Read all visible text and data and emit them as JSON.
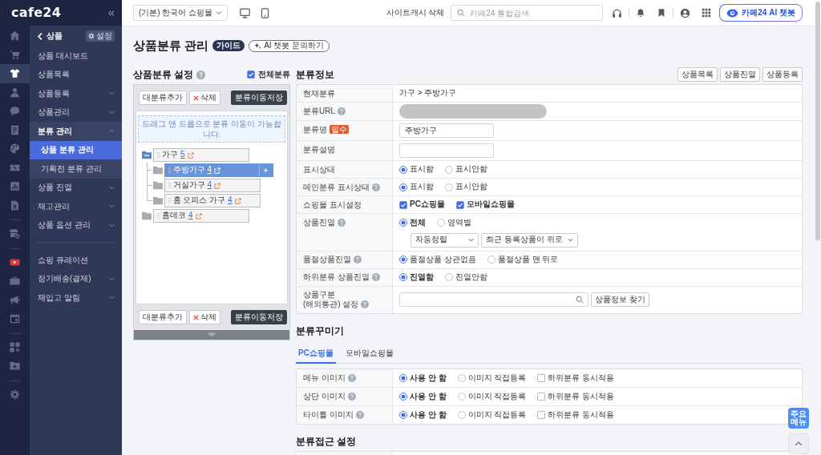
{
  "sidebar": {
    "logo": "cafe24",
    "rail": [
      [
        {
          "selected": false
        },
        {
          "selected": false
        },
        {
          "selected": true
        },
        {
          "selected": false
        },
        {
          "selected": false
        },
        {
          "selected": false
        },
        {
          "selected": false
        },
        {
          "selected": false
        },
        {
          "selected": false
        },
        {
          "selected": false
        }
      ],
      [
        {
          "selected": false
        }
      ],
      [
        {
          "selected": false
        },
        {
          "selected": false
        },
        {
          "selected": false
        },
        {
          "selected": false
        }
      ],
      [
        {
          "selected": false
        },
        {
          "selected": false
        }
      ],
      [
        {
          "selected": false
        }
      ]
    ],
    "menu": {
      "title": "상품",
      "settings_button": "설정",
      "sections": [
        [
          {
            "label": "상품 대시보드",
            "kind": "link",
            "selected": false
          },
          {
            "label": "상품목록",
            "kind": "link",
            "selected": false
          },
          {
            "label": "상품등록",
            "kind": "group",
            "selected": false,
            "expanded": false
          },
          {
            "label": "상품관리",
            "kind": "group",
            "selected": false,
            "expanded": false
          },
          {
            "label": "분류 관리",
            "kind": "group",
            "selected": false,
            "expanded": true,
            "children": [
              {
                "label": "상품 분류 관리",
                "selected": true
              },
              {
                "label": "기획전 분류 관리",
                "selected": false
              }
            ]
          },
          {
            "label": "상품 진열",
            "kind": "group",
            "selected": false,
            "expanded": false
          },
          {
            "label": "재고관리",
            "kind": "group",
            "selected": false,
            "expanded": false
          },
          {
            "label": "상품 옵션 관리",
            "kind": "group",
            "selected": false,
            "expanded": false
          }
        ],
        [
          {
            "label": "쇼핑 큐레이션",
            "kind": "link",
            "selected": false
          },
          {
            "label": "정기배송(결제)",
            "kind": "group",
            "selected": false,
            "expanded": false
          },
          {
            "label": "재입고 알림",
            "kind": "group",
            "selected": false,
            "expanded": false
          }
        ]
      ]
    }
  },
  "topbar": {
    "shop_select": "(기본) 한국어 쇼핑몰",
    "cache_button": "사이트캐시 삭제",
    "search_placeholder": "카페24 통합검색",
    "ai_button": "카페24 AI 챗봇"
  },
  "page": {
    "title": "상품분류 관리",
    "guide_badge": "가이드",
    "ai_link": "AI 챗봇 문의하기"
  },
  "category_tree": {
    "title": "상품분류 설정",
    "help": true,
    "all_categories": {
      "label": "전체분류",
      "checked": true
    },
    "top_toolbar": {
      "add": "대분류추가",
      "delete": "삭제",
      "save": "분류이동저장"
    },
    "hint": "드래그 앤 드롭으로 분류 이동이 가능합니다.",
    "nodes": [
      {
        "label": "가구",
        "count": "5",
        "expanded": true,
        "selected": false,
        "children": [
          {
            "label": "주방가구",
            "count": "4",
            "expanded": false,
            "selected": true
          },
          {
            "label": "거실가구",
            "count": "4",
            "expanded": false,
            "selected": false
          },
          {
            "label": "홈 오피스 가구",
            "count": "4",
            "expanded": false,
            "selected": false
          }
        ]
      },
      {
        "label": "홈데코",
        "count": "4",
        "expanded": false,
        "selected": false
      }
    ],
    "bottom_toolbar": {
      "add": "대분류추가",
      "delete": "삭제",
      "save": "분류이동저장"
    }
  },
  "category_info": {
    "title": "분류정보",
    "buttons": [
      "상품목록",
      "상품진열",
      "상품등록"
    ],
    "rows": [
      {
        "kind": "text",
        "label": "현재분류",
        "help": false,
        "value": "가구 > 주방가구"
      },
      {
        "kind": "masked",
        "label": "분류URL",
        "help": true
      },
      {
        "kind": "input",
        "label": "분류명",
        "help": false,
        "required": "필수",
        "value": "주방가구"
      },
      {
        "kind": "input",
        "label": "분류설명",
        "help": false
      },
      {
        "kind": "radio",
        "label": "표시상태",
        "help": false,
        "options": [
          {
            "label": "표시함",
            "selected": true,
            "bold": false
          },
          {
            "label": "표시안함",
            "selected": false,
            "bold": false
          }
        ]
      },
      {
        "kind": "radio",
        "label": "메인분류 표시상태",
        "help": true,
        "options": [
          {
            "label": "표시함",
            "selected": true,
            "bold": false
          },
          {
            "label": "표시안함",
            "selected": false,
            "bold": false
          }
        ]
      },
      {
        "kind": "checkbox",
        "label": "쇼핑몰 표시설정",
        "help": false,
        "options": [
          {
            "label": "PC쇼핑몰",
            "checked": true,
            "bold": true
          },
          {
            "label": "모바일쇼핑몰",
            "checked": true,
            "bold": true
          }
        ]
      },
      {
        "kind": "radio",
        "label": "상품진열",
        "help": true,
        "options": [
          {
            "label": "전체",
            "selected": true,
            "bold": true
          },
          {
            "label": "영역별",
            "selected": false,
            "bold": false
          }
        ],
        "selects": [
          "자동정렬",
          "최근 등록상품이 위로"
        ]
      },
      {
        "kind": "radio",
        "label": "품절상품진열",
        "help": true,
        "options": [
          {
            "label": "품절상품 상관없음",
            "selected": true,
            "bold": false
          },
          {
            "label": "품절상품 맨 뒤로",
            "selected": false,
            "bold": false
          }
        ]
      },
      {
        "kind": "radio",
        "label": "하위분류 상품진열",
        "help": true,
        "options": [
          {
            "label": "진열함",
            "selected": true,
            "bold": true
          },
          {
            "label": "진열안함",
            "selected": false,
            "bold": false
          }
        ]
      },
      {
        "kind": "search",
        "label": "상품구분\n(해외통관) 설정",
        "help": true,
        "button": "상품정보 찾기"
      }
    ]
  },
  "decoration": {
    "title": "분류꾸미기",
    "tabs": [
      {
        "label": "PC쇼핑몰",
        "selected": true
      },
      {
        "label": "모바일쇼핑몰",
        "selected": false
      }
    ],
    "rows": [
      {
        "label": "메뉴 이미지",
        "help": true,
        "options": [
          {
            "label": "사용 안 함",
            "selected": true,
            "bold": true
          },
          {
            "label": "이미지 직접등록",
            "selected": false,
            "bold": false
          }
        ],
        "apply_subcategories": {
          "label": "하위분류 동시적용",
          "checked": false
        }
      },
      {
        "label": "상단 이미지",
        "help": true,
        "options": [
          {
            "label": "사용 안 함",
            "selected": true,
            "bold": true
          },
          {
            "label": "이미지 직접등록",
            "selected": false,
            "bold": false
          }
        ],
        "apply_subcategories": {
          "label": "하위분류 동시적용",
          "checked": false
        }
      },
      {
        "label": "타이틀 이미지",
        "help": true,
        "options": [
          {
            "label": "사용 안 함",
            "selected": true,
            "bold": true
          },
          {
            "label": "이미지 직접등록",
            "selected": false,
            "bold": false
          }
        ],
        "apply_subcategories": {
          "label": "하위분류 동시적용",
          "checked": false
        }
      }
    ]
  },
  "access": {
    "title": "분류접근 설정"
  },
  "quick_menu": "주요\n메뉴"
}
